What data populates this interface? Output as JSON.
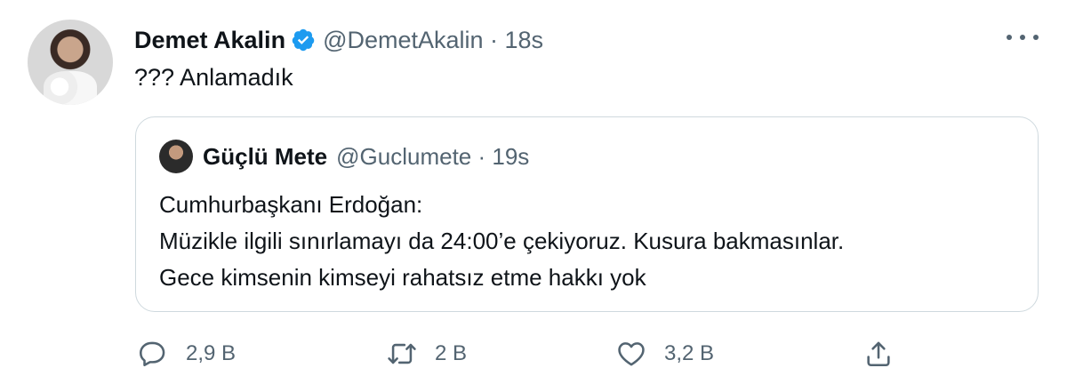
{
  "tweet": {
    "author_name": "Demet Akalin",
    "handle_time": "@DemetAkalin · 18s",
    "text": "??? Anlamadık"
  },
  "quoted": {
    "author_name": "Güçlü Mete",
    "handle_time": "@Guclumete · 19s",
    "lines": [
      "Cumhurbaşkanı Erdoğan:",
      "Müzikle ilgili sınırlamayı da 24:00’e çekiyoruz. Kusura bakmasınlar.",
      "Gece kimsenin kimseyi rahatsız etme hakkı yok"
    ]
  },
  "actions": {
    "reply_count": "2,9 B",
    "retweet_count": "2 B",
    "like_count": "3,2 B"
  },
  "icons": {
    "verified": "verified-badge-icon",
    "more": "more-options-icon",
    "reply": "reply-icon",
    "retweet": "retweet-icon",
    "like": "like-icon",
    "share": "share-icon"
  },
  "colors": {
    "text": "#0f1419",
    "secondary": "#536471",
    "verified": "#1d9bf0",
    "border": "#cfd9de"
  }
}
